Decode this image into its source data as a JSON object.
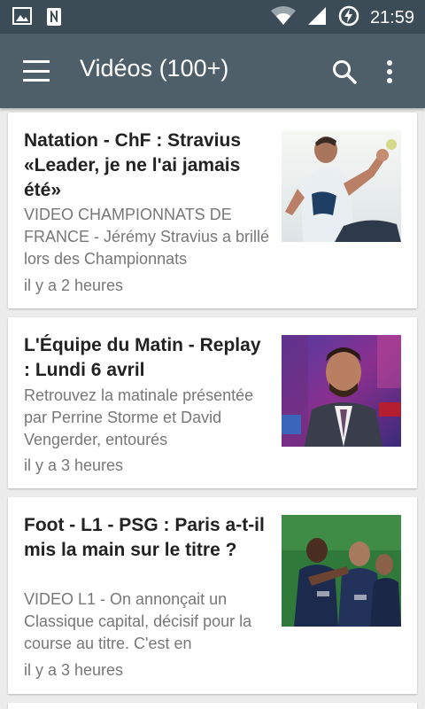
{
  "status_bar": {
    "time": "21:59",
    "left_icons": [
      "image-notification-icon",
      "app-notification-icon"
    ],
    "right_icons": [
      "wifi-icon",
      "signal-icon",
      "battery-charging-icon"
    ]
  },
  "app_bar": {
    "title": "Vidéos (100+)",
    "background": "#4e5f69",
    "status_bar_color": "#3b4c56"
  },
  "cards": [
    {
      "title": "Natation - ChF : Stravius «Leader, je ne l'ai jamais été»",
      "description": " VIDEO CHAMPIONNATS DE FRANCE - Jérémy Stravius a brillé lors des Championnats",
      "time": "il y a 2 heures",
      "thumbnail": "swimmer-photo"
    },
    {
      "title": "L'Équipe du Matin - Replay : Lundi 6 avril",
      "description": " Retrouvez la matinale présentée par Perrine Storme et David Vengerder, entourés",
      "time": "il y a 3 heures",
      "thumbnail": "tv-presenter-photo"
    },
    {
      "title": "Foot - L1 - PSG : Paris a-t-il mis la main sur le titre ?",
      "description": " VIDEO L1 - On annonçait un Classique capital, décisif pour la course au titre. C'est en",
      "time": "il y a 3 heures",
      "thumbnail": "football-players-photo"
    }
  ]
}
